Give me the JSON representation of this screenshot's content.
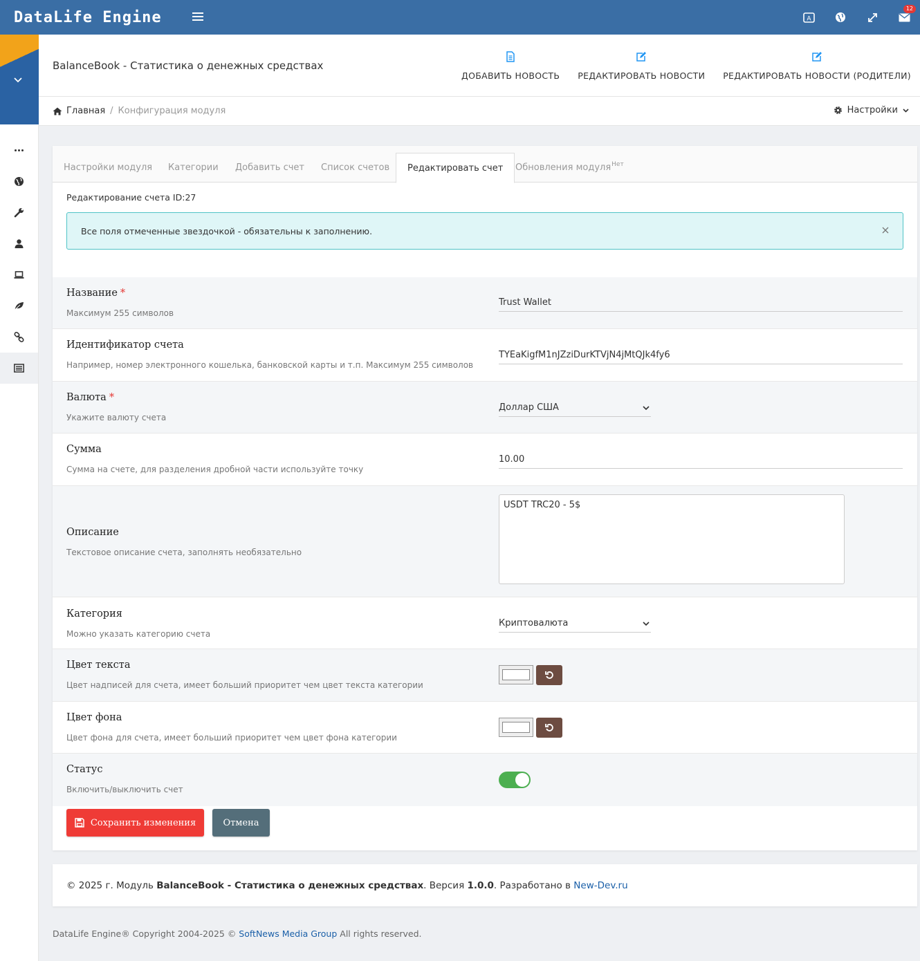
{
  "navbar": {
    "brand": "DataLife Engine",
    "notifications_count": "12"
  },
  "page": {
    "title": "BalanceBook - Статистика о денежных средствах"
  },
  "header_actions": [
    {
      "label": "ДОБАВИТЬ НОВОСТЬ",
      "icon": "file-text-icon"
    },
    {
      "label": "РЕДАКТИРОВАТЬ НОВОСТИ",
      "icon": "edit-icon"
    },
    {
      "label": "РЕДАКТИРОВАТЬ НОВОСТИ (РОДИТЕЛИ)",
      "icon": "edit-icon"
    }
  ],
  "breadcrumb": {
    "home": "Главная",
    "separator": "/",
    "current": "Конфигурация модуля"
  },
  "settings_dropdown": "Настройки",
  "tabs": [
    {
      "label": "Настройки модуля"
    },
    {
      "label": "Категории"
    },
    {
      "label": "Добавить счет"
    },
    {
      "label": "Список счетов"
    },
    {
      "label": "Редактировать счет",
      "active": true
    },
    {
      "label": "Обновления модуля",
      "sup": "Нет"
    }
  ],
  "form": {
    "heading": "Редактирование счета ID:27",
    "alert": "Все поля отмеченные звездочкой - обязательны к заполнению.",
    "required_mark": "*",
    "fields": {
      "name": {
        "title": "Название",
        "desc": "Максимум 255 символов",
        "value": "Trust Wallet"
      },
      "account_id": {
        "title": "Идентификатор счета",
        "desc": "Например, номер электронного кошелька, банковской карты и т.п. Максимум 255 символов",
        "value": "TYEaKigfM1nJZziDurKTVjN4jMtQJk4fy6"
      },
      "currency": {
        "title": "Валюта",
        "desc": "Укажите валюту счета",
        "value": "Доллар США"
      },
      "amount": {
        "title": "Сумма",
        "desc": "Сумма на счете, для разделения дробной части используйте точку",
        "value": "10.00"
      },
      "description": {
        "title": "Описание",
        "desc": "Текстовое описание счета, заполнять необязательно",
        "value": "USDT TRC20 - 5$"
      },
      "category": {
        "title": "Категория",
        "desc": "Можно указать категорию счета",
        "value": "Криптовалюта"
      },
      "text_color": {
        "title": "Цвет текста",
        "desc": "Цвет надписей для счета, имеет больший приоритет чем цвет текста категории",
        "value": "#ffffff"
      },
      "bg_color": {
        "title": "Цвет фона",
        "desc": "Цвет фона для счета, имеет больший приоритет чем цвет фона категории",
        "value": "#ffffff"
      },
      "status": {
        "title": "Статус",
        "desc": "Включить/выключить счет",
        "enabled": true
      }
    },
    "save_label": "Сохранить изменения",
    "cancel_label": "Отмена"
  },
  "footer": {
    "prefix": "© 2025 г. Модуль ",
    "module_name": "BalanceBook - Статистика о денежных средствах",
    "version_label": ". Версия ",
    "version": "1.0.0",
    "dev_label": ". Разработано в ",
    "dev_link": "New-Dev.ru"
  },
  "copyright": {
    "prefix": "DataLife Engine® Copyright 2004-2025 © ",
    "company": "SoftNews Media Group",
    "suffix": " All rights reserved."
  },
  "colors": {
    "navbar": "#3a6ea5",
    "accent_link": "#1a5fa8",
    "save_button": "#ef3b36",
    "cancel_button": "#546e7a",
    "toggle_on": "#4caf50",
    "alert_bg": "#dff6f7",
    "header_icon": "#2196f3"
  }
}
